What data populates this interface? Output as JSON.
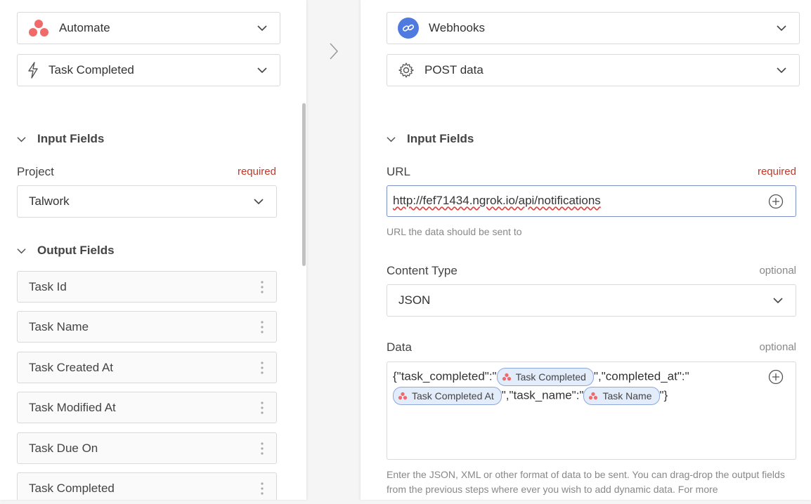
{
  "left": {
    "app_select": {
      "label": "Automate",
      "icon": "asana-logo-icon"
    },
    "trigger_select": {
      "label": "Task Completed",
      "icon": "lightning-icon"
    },
    "input_section": {
      "title": "Input Fields"
    },
    "project_field": {
      "label": "Project",
      "tag": "required",
      "value": "Talwork"
    },
    "output_section": {
      "title": "Output Fields"
    },
    "output_fields": [
      "Task Id",
      "Task Name",
      "Task Created At",
      "Task Modified At",
      "Task Due On",
      "Task Completed"
    ]
  },
  "right": {
    "app_select": {
      "label": "Webhooks",
      "icon": "webhook-icon"
    },
    "action_select": {
      "label": "POST data",
      "icon": "gear-icon"
    },
    "input_section": {
      "title": "Input Fields"
    },
    "url_field": {
      "label": "URL",
      "tag": "required",
      "value": "http://fef71434.ngrok.io/api/notifications",
      "help": "URL the data should be sent to"
    },
    "content_type_field": {
      "label": "Content Type",
      "tag": "optional",
      "value": "JSON"
    },
    "data_field": {
      "label": "Data",
      "tag": "optional",
      "text_1": "{\"task_completed\":\"",
      "pill_1": "Task Completed",
      "text_2": "\",\"completed_at\":\"",
      "pill_2": "Task Completed At",
      "text_3": "\",\"task_name\":\"",
      "pill_3": "Task Name",
      "text_4": "\"}",
      "help": "Enter the JSON, XML or other format of data to be sent. You can drag-drop the output fields from the previous steps where ever you wish to add dynamic data. For more"
    }
  },
  "colors": {
    "required": "#c0392b",
    "optional": "#888888",
    "pill_bg": "#e3ecfa",
    "pill_border": "#8ea7d9",
    "asana": "#f06a6a",
    "webhook_bg": "#4f7be0"
  }
}
